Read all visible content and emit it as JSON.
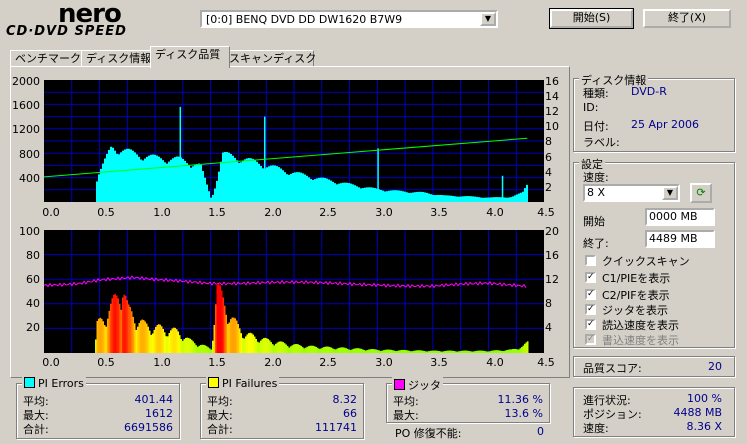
{
  "app": {
    "logo_main": "nero",
    "logo_sub": "CD·DVD SPEED"
  },
  "toolbar": {
    "drive_value": "[0:0]    BENQ DVD DD DW1620 B7W9",
    "start_label": "開始(S)",
    "exit_label": "終了(X)"
  },
  "tabs": [
    "ベンチマーク",
    "ディスク情報",
    "ディスク品質",
    "スキャンディスク"
  ],
  "active_tab": 2,
  "colors": {
    "pie": "#00ffff",
    "pif": "#ffff00",
    "jitter": "#ff00ff",
    "speed": "#00ff00",
    "grid": "#0000c0",
    "chart_bg": "#000000"
  },
  "chart_data": [
    {
      "type": "area",
      "id": "pie_chart",
      "x": [
        0.0,
        0.45,
        0.47,
        0.6,
        0.8,
        1.0,
        1.2,
        1.4,
        1.5,
        1.55,
        1.6,
        1.8,
        2.0,
        2.2,
        2.4,
        2.6,
        2.8,
        3.0,
        3.2,
        3.4,
        3.6,
        3.8,
        4.0,
        4.2,
        4.3,
        4.35
      ],
      "pie_values": [
        0,
        0,
        380,
        880,
        770,
        700,
        680,
        580,
        40,
        380,
        760,
        680,
        580,
        480,
        400,
        330,
        260,
        200,
        170,
        150,
        100,
        90,
        70,
        80,
        150,
        320
      ],
      "speed_x": [
        0.0,
        4.35
      ],
      "speed_values": [
        3.3,
        8.36
      ],
      "ylim_left": [
        0,
        2000
      ],
      "ylim_right": [
        0,
        16
      ],
      "xlim": [
        0,
        4.5
      ],
      "yticks_left": [
        "2000",
        "1600",
        "1200",
        "800",
        "400"
      ],
      "yticks_right": [
        "16",
        "14",
        "12",
        "10",
        "8",
        "6",
        "4",
        "2"
      ],
      "xticks": [
        "0.0",
        "0.5",
        "1.0",
        "1.5",
        "2.0",
        "2.5",
        "3.0",
        "3.5",
        "4.0",
        "4.5"
      ]
    },
    {
      "type": "area",
      "id": "pif_chart",
      "x": [
        0.0,
        0.45,
        0.47,
        0.55,
        0.65,
        0.7,
        0.75,
        0.9,
        1.1,
        1.2,
        1.3,
        1.5,
        1.55,
        1.6,
        1.7,
        1.8,
        2.0,
        2.2,
        2.4,
        2.6,
        2.8,
        3.0,
        3.5,
        4.0,
        4.2,
        4.3,
        4.35
      ],
      "pif_values": [
        0,
        0,
        26,
        36,
        52,
        66,
        40,
        26,
        22,
        20,
        12,
        4,
        62,
        50,
        30,
        18,
        12,
        8,
        6,
        5,
        4,
        3,
        2,
        2,
        3,
        6,
        10
      ],
      "jitter_x": [
        0.0,
        0.3,
        0.5,
        0.8,
        1.0,
        1.5,
        2.0,
        2.5,
        3.0,
        3.5,
        4.0,
        4.35
      ],
      "jitter_values": [
        11.0,
        11.4,
        12.0,
        12.2,
        11.8,
        11.4,
        11.5,
        11.3,
        11.2,
        10.8,
        11.3,
        11.0
      ],
      "ylim_left": [
        0,
        100
      ],
      "ylim_right": [
        0,
        20
      ],
      "xlim": [
        0,
        4.5
      ],
      "yticks_left": [
        "100",
        "80",
        "60",
        "40",
        "20"
      ],
      "yticks_right": [
        "20",
        "16",
        "12",
        "8",
        "4"
      ],
      "xticks": [
        "0.0",
        "0.5",
        "1.0",
        "1.5",
        "2.0",
        "2.5",
        "3.0",
        "3.5",
        "4.0",
        "4.5"
      ]
    }
  ],
  "pi_errors": {
    "title": "PI Errors",
    "avg_label": "平均:",
    "avg": "401.44",
    "max_label": "最大:",
    "max": "1612",
    "total_label": "合計:",
    "total": "6691586"
  },
  "pi_failures": {
    "title": "PI Failures",
    "avg_label": "平均:",
    "avg": "8.32",
    "max_label": "最大:",
    "max": "66",
    "total_label": "合計:",
    "total": "111741"
  },
  "jitter": {
    "title": "ジッタ",
    "avg_label": "平均:",
    "avg": "11.36 %",
    "max_label": "最大:",
    "max": "13.6 %",
    "po_label": "PO 修復不能:",
    "po": "0"
  },
  "disc_info": {
    "title": "ディスク情報",
    "type_label": "種類:",
    "type": "DVD-R",
    "id_label": "ID:",
    "id": "",
    "date_label": "日付:",
    "date": "25 Apr 2006",
    "label_label": "ラベル:",
    "label": ""
  },
  "settings": {
    "title": "設定",
    "speed_label": "速度:",
    "speed": "8 X",
    "start_label": "開始",
    "start": "0000 MB",
    "end_label": "終了:",
    "end": "4489 MB",
    "checks": [
      {
        "label": "クイックスキャン",
        "checked": false,
        "disabled": false
      },
      {
        "label": "C1/PIEを表示",
        "checked": true,
        "disabled": false
      },
      {
        "label": "C2/PIFを表示",
        "checked": true,
        "disabled": false
      },
      {
        "label": "ジッタを表示",
        "checked": true,
        "disabled": false
      },
      {
        "label": "読込速度を表示",
        "checked": true,
        "disabled": false
      },
      {
        "label": "書込速度を表示",
        "checked": true,
        "disabled": true
      }
    ]
  },
  "quality": {
    "label": "品質スコア:",
    "value": "20"
  },
  "progress": {
    "status_label": "進行状況:",
    "status": "100 %",
    "position_label": "ポジション:",
    "position": "4488 MB",
    "speed_label": "速度:",
    "speed": "8.36 X"
  }
}
